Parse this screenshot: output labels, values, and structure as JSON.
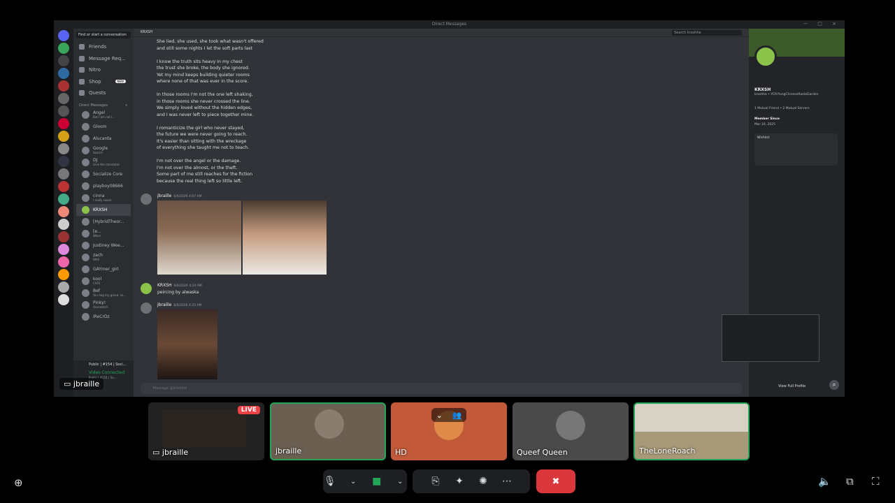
{
  "window": {
    "title": "Direct Messages"
  },
  "dm_sidebar": {
    "search_placeholder": "Find or start a conversation",
    "nav": [
      {
        "label": "Friends"
      },
      {
        "label": "Message Req..."
      },
      {
        "label": "Nitro"
      },
      {
        "label": "Shop",
        "badge": "NEW"
      },
      {
        "label": "Quests"
      }
    ],
    "dm_header": "Direct Messages",
    "dms": [
      {
        "name": "Angel",
        "sub": "But I am not t..."
      },
      {
        "name": "Gloom",
        "sub": ""
      },
      {
        "name": "Alucarda",
        "sub": ""
      },
      {
        "name": "Google",
        "sub": "Search"
      },
      {
        "name": "DJ",
        "sub": "Give the mandates"
      },
      {
        "name": "Socialize Core",
        "sub": ""
      },
      {
        "name": "playboy08666",
        "sub": ""
      },
      {
        "name": "cinna",
        "sub": "I really swam"
      },
      {
        "name": "KRXSH",
        "sub": ""
      },
      {
        "name": "[HybridTheor...",
        "sub": ""
      },
      {
        "name": "[e...",
        "sub": "Wave"
      },
      {
        "name": "Justiney Wee...",
        "sub": ""
      },
      {
        "name": "zach",
        "sub": "WAX"
      },
      {
        "name": "GAYmer_girl",
        "sub": ""
      },
      {
        "name": "kool",
        "sub": "CAFE"
      },
      {
        "name": "Bef",
        "sub": "You dug my grave, so..."
      },
      {
        "name": "Pinky!",
        "sub": "Overwatch"
      },
      {
        "name": "iReCrDz",
        "sub": ""
      }
    ],
    "voice": {
      "server": "Public | #154 | Soci...",
      "status": "Video Connected",
      "channel": "Public | #154 | So..."
    }
  },
  "chat": {
    "header_name": "KRXSH",
    "search_placeholder": "Search krxshhe",
    "poem": "She lied, she used, she took what wasn't offered\nand still some nights I let the soft parts last\n\nI know the truth sits heavy in my chest\nthe trust she broke, the body she ignored.\nYet my mind keeps building quieter rooms\nwhere none of that was ever in the score.\n\nIn those rooms I'm not the one left shaking,\nin those rooms she never crossed the line.\nWe simply loved without the hidden edges,\nand I was never left to piece together mine.\n\nI romanticize the girl who never stayed,\nthe future we were never going to reach.\nIt's easier than sitting with the wreckage\nof everything she taught me not to teach.\n\nI'm not over the angel or the damage.\nI'm not over the almost, or the theft.\nSome part of me still reaches for the fiction\nbecause the real thing left so little left.",
    "messages": [
      {
        "author": "jbraille",
        "timestamp": "6/6/2026 4:07 AM",
        "text": ""
      },
      {
        "author": "KRXSH",
        "timestamp": "6/6/2026 4:24 AM",
        "text": "peircing by alwaska"
      },
      {
        "author": "jbraille",
        "timestamp": "6/6/2026 4:25 AM",
        "text": ""
      }
    ],
    "composer_placeholder": "Message @krxshhe"
  },
  "profile": {
    "name": "KRXSH",
    "subtitle": "krxshhe • YCR/YungChineseRastaGarden",
    "mutuals": "1 Mutual Friend • 2 Mutual Servers",
    "member_since_label": "Member Since",
    "member_since": "Mar 10, 2025",
    "wishlist_label": "Wishlist",
    "view_full_profile": "View Full Profile"
  },
  "screen_label": "jbraille",
  "participants": [
    {
      "name": "jbraille",
      "live": "LIVE",
      "speaking": false
    },
    {
      "name": "jbraille",
      "speaking": true
    },
    {
      "name": "HD",
      "speaking": false
    },
    {
      "name": "Queef Queen",
      "speaking": false
    },
    {
      "name": "TheLoneRoach",
      "speaking": true
    }
  ],
  "colors": {
    "live": "#ed4245",
    "speaking_ring": "#23a55a",
    "leave_button": "#da373c",
    "accent": "#5865f2"
  }
}
